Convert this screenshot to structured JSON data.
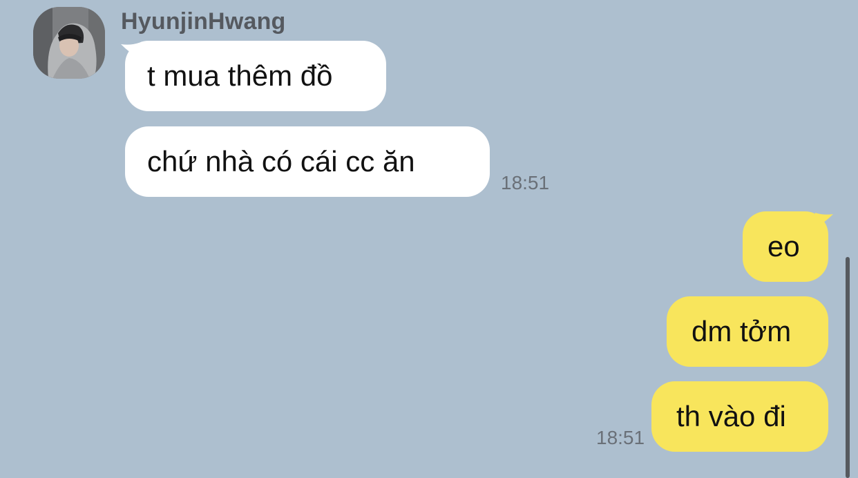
{
  "incoming": {
    "sender": "HyunjinHwang",
    "messages": [
      {
        "text": "t mua thêm đồ"
      },
      {
        "text": "chứ nhà có cái cc ăn"
      }
    ],
    "time": "18:51"
  },
  "outgoing": {
    "messages": [
      {
        "text": "eo"
      },
      {
        "text": "dm tởm"
      },
      {
        "text": "th vào đi"
      }
    ],
    "time": "18:51"
  },
  "colors": {
    "background": "#adbfcf",
    "incoming_bubble": "#ffffff",
    "outgoing_bubble": "#f8e55c"
  }
}
